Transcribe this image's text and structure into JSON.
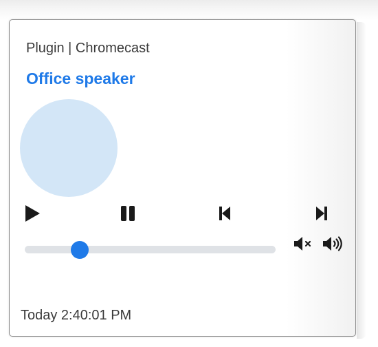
{
  "card": {
    "plugin_title": "Plugin | Chromecast",
    "device_name": "Office speaker",
    "timestamp": "Today 2:40:01 PM"
  },
  "controls": {
    "play_icon": "play-icon",
    "pause_icon": "pause-icon",
    "previous_icon": "skip-previous-icon",
    "next_icon": "skip-next-icon",
    "mute_icon": "volume-mute-icon",
    "volume_up_icon": "volume-up-icon"
  },
  "progress": {
    "value_percent": 22
  },
  "colors": {
    "accent": "#1f7ae8",
    "artwork_placeholder": "#d3e6f7",
    "track": "#dfe2e6",
    "text": "#3a3a3a"
  }
}
